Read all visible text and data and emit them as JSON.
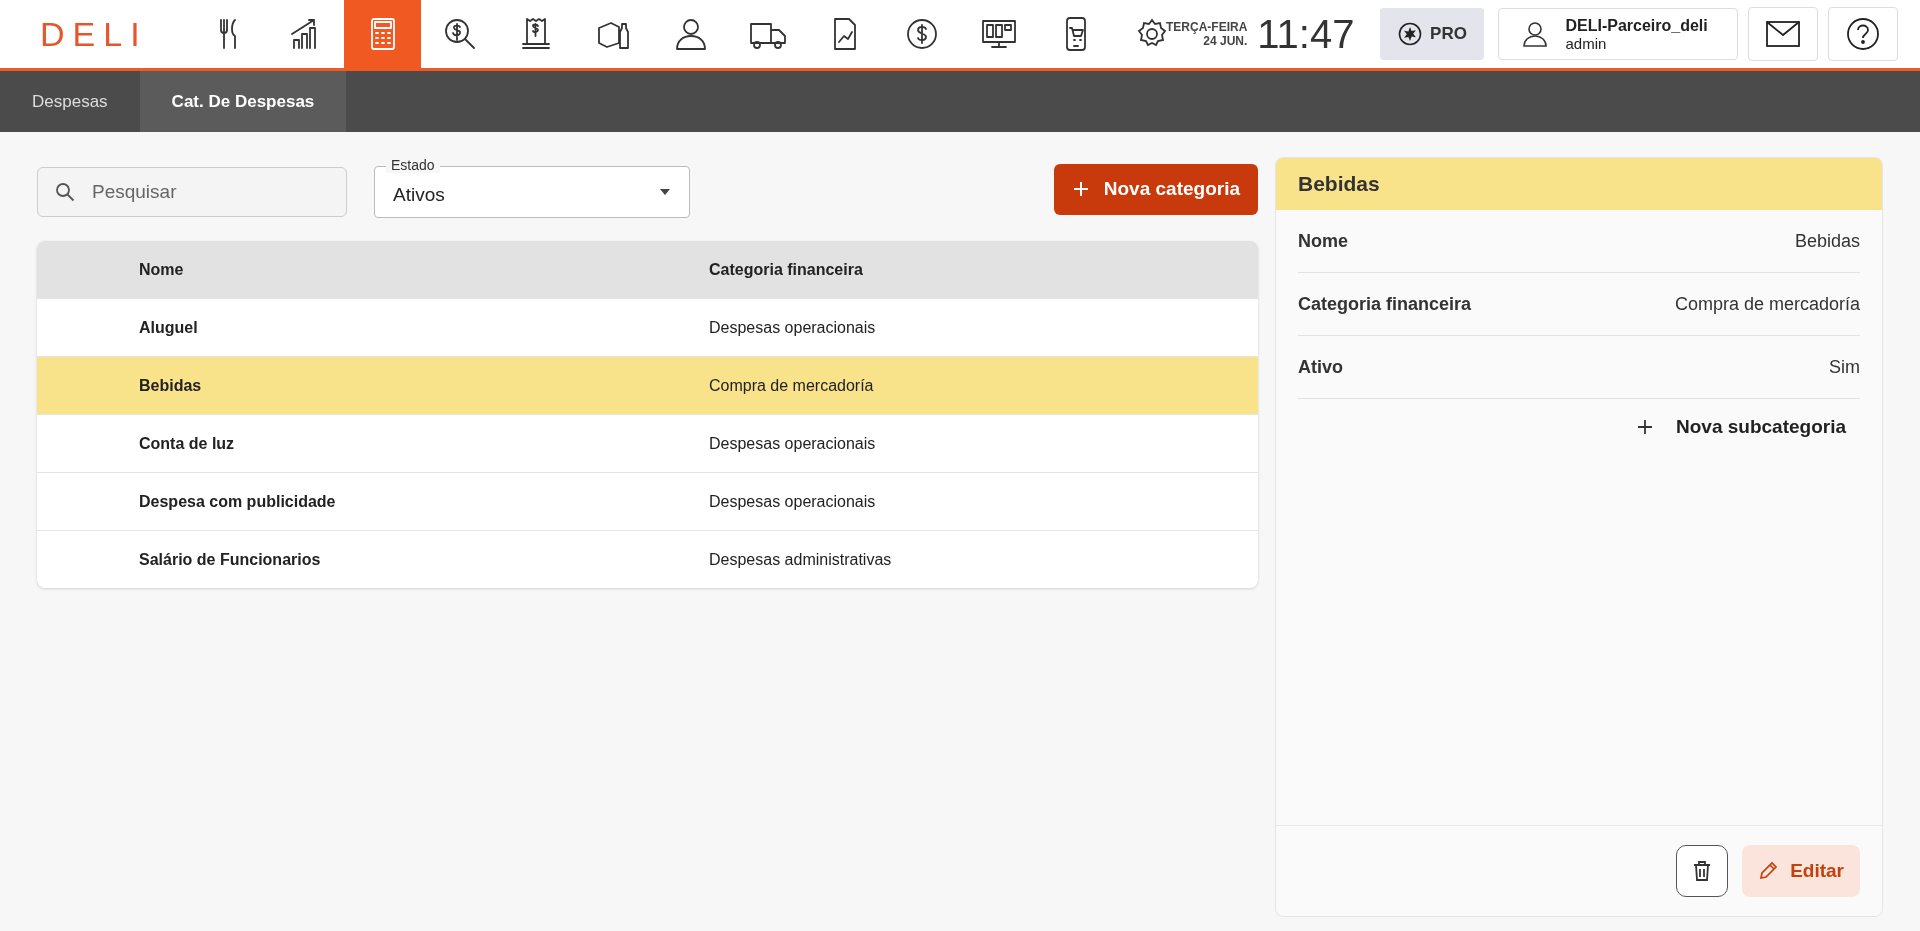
{
  "logo": "DELI",
  "nav_icons": [
    {
      "kind": "cutlery",
      "selected": false
    },
    {
      "kind": "chart",
      "selected": false
    },
    {
      "kind": "calculator",
      "selected": true
    },
    {
      "kind": "money-search",
      "selected": false
    },
    {
      "kind": "receipt",
      "selected": false
    },
    {
      "kind": "groceries",
      "selected": false
    },
    {
      "kind": "person",
      "selected": false
    },
    {
      "kind": "truck",
      "selected": false
    },
    {
      "kind": "report",
      "selected": false
    },
    {
      "kind": "dollar",
      "selected": false
    },
    {
      "kind": "monitor",
      "selected": false
    },
    {
      "kind": "phone-cart",
      "selected": false
    }
  ],
  "clock": {
    "weekday": "TERÇA-FEIRA",
    "date": "24 JUN.",
    "time": "11:47"
  },
  "plan_badge": "PRO",
  "user": {
    "name": "DELI-Parceiro_deli",
    "role": "admin"
  },
  "tabs": [
    {
      "label": "Despesas",
      "selected": false
    },
    {
      "label": "Cat. De Despesas",
      "selected": true
    }
  ],
  "search": {
    "placeholder": "Pesquisar"
  },
  "state_select": {
    "label": "Estado",
    "value": "Ativos"
  },
  "new_button": "Nova categoria",
  "table": {
    "columns": [
      "Nome",
      "Categoria financeira"
    ],
    "rows": [
      {
        "name": "Aluguel",
        "category": "Despesas operacionais",
        "selected": false
      },
      {
        "name": "Bebidas",
        "category": "Compra de mercadoría",
        "selected": true
      },
      {
        "name": "Conta de luz",
        "category": "Despesas operacionais",
        "selected": false
      },
      {
        "name": "Despesa com publicidade",
        "category": "Despesas operacionais",
        "selected": false
      },
      {
        "name": "Salário de Funcionarios",
        "category": "Despesas administrativas",
        "selected": false
      }
    ]
  },
  "detail": {
    "title": "Bebidas",
    "fields": [
      {
        "label": "Nome",
        "value": "Bebidas"
      },
      {
        "label": "Categoria financeira",
        "value": "Compra de mercadoría"
      },
      {
        "label": "Ativo",
        "value": "Sim"
      }
    ],
    "add_sub": "Nova subcategoria",
    "edit_button": "Editar"
  }
}
